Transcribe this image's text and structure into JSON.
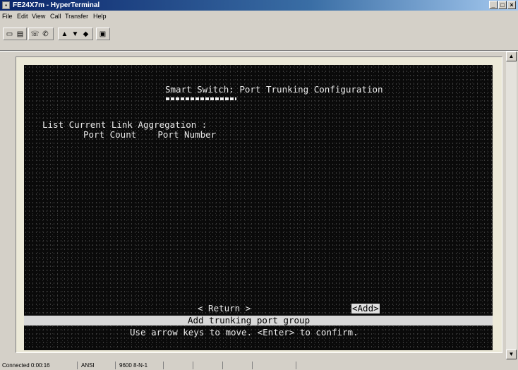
{
  "window": {
    "title": "FE24X7m - HyperTerminal",
    "icon": "hyperterminal-icon"
  },
  "menu": [
    "File",
    "Edit",
    "View",
    "Call",
    "Transfer",
    "Help"
  ],
  "toolbar": {
    "icons": [
      "new-icon",
      "open-icon",
      "connect-icon",
      "disconnect-icon",
      "send-icon",
      "receive-icon",
      "properties-icon"
    ]
  },
  "terminal": {
    "title": "Smart Switch: Port Trunking Configuration",
    "list_label": "List Current Link Aggregation :",
    "col_port_count": "Port Count",
    "col_port_number": "Port Number",
    "return_label": "< Return >",
    "add_label": "<Add>",
    "status_text": "Add trunking port group",
    "help_text": "Use arrow keys to move. <Enter> to confirm."
  },
  "statusbar": [
    "Connected 0:00:16",
    "ANSI",
    "9600 8-N-1",
    "",
    "",
    "",
    ""
  ]
}
